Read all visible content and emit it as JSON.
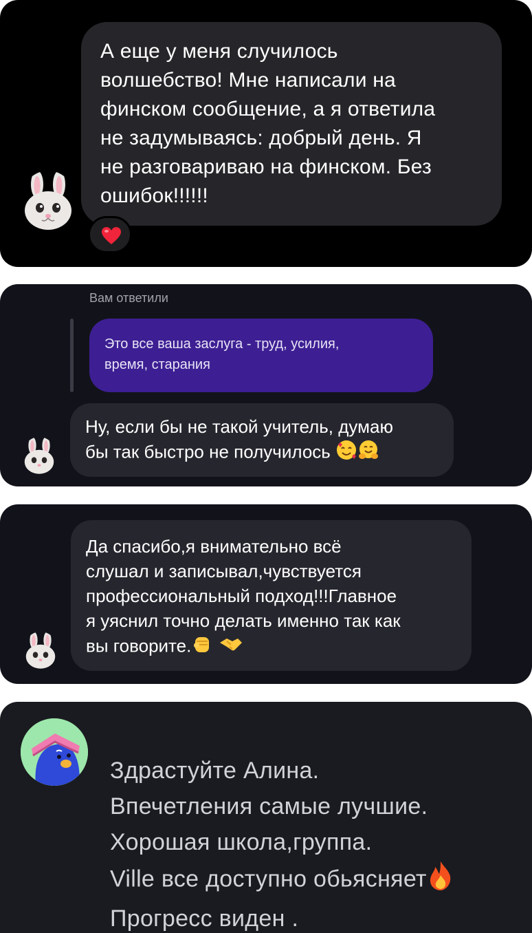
{
  "card1": {
    "message": "А еще у меня случилось\nволшебство! Мне написали на\nфинском сообщение, а я ответила\nне задумываясь: добрый день. Я\nне разговариваю на финском. Без\nошибок!!!!!!",
    "reaction_icon": "red-heart-icon"
  },
  "card2": {
    "reply_label": "Вам ответили",
    "quoted_message": "Это все ваша заслуга - труд, усилия,\nвремя, старания",
    "message": "Ну, если бы не такой учитель, думаю\nбы так быстро не получилось",
    "emojis": [
      "smiling-face-with-hearts-icon",
      "hugging-face-icon"
    ]
  },
  "card3": {
    "message": "Да спасибо,я внимательно всё\nслушал и записывал,чувствуется\nпрофессиональный подход!!!Главное\nя уяснил точно делать именно так как\nвы говорите.",
    "emojis": [
      "raised-fist-icon",
      "handshake-icon"
    ]
  },
  "card4": {
    "message": "Здрастуйте Алина.\nВпечетления самыe лучшие.\nХорошая школа,группа.\nVille все доступно обьясняет",
    "message_last_line": "Прогресс виден .",
    "emojis": [
      "fire-icon"
    ]
  },
  "colors": {
    "card_dark": "#000000",
    "card_navy": "#12131a",
    "bubble_gray": "#26272e",
    "bubble_purple": "#3d1f93",
    "avatar_green": "#9de7ac"
  }
}
